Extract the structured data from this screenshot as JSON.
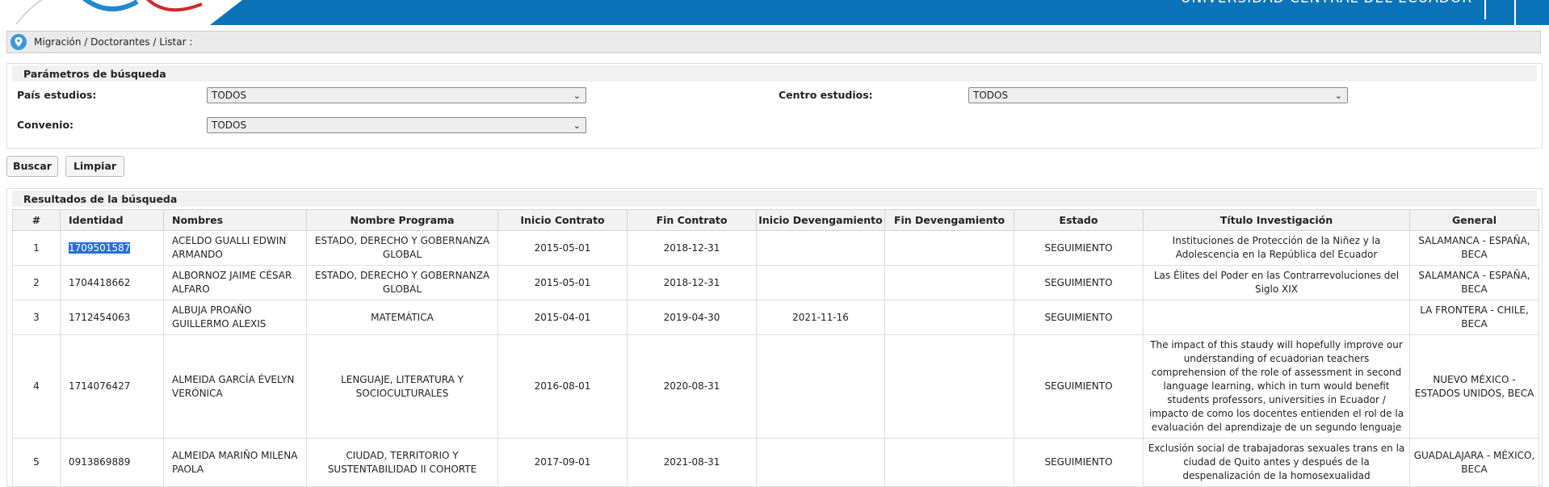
{
  "header": {
    "university": "UNIVERSIDAD CENTRAL DEL ECUADOR"
  },
  "breadcrumb": {
    "text": "Migración / Doctorantes / Listar :"
  },
  "search": {
    "title": "Parámetros de búsqueda",
    "pais_label": "País estudios:",
    "pais_value": "TODOS",
    "centro_label": "Centro estudios:",
    "centro_value": "TODOS",
    "convenio_label": "Convenio:",
    "convenio_value": "TODOS"
  },
  "buttons": {
    "buscar": "Buscar",
    "limpiar": "Limpiar"
  },
  "results": {
    "title": "Resultados de la búsqueda",
    "columns": [
      "#",
      "Identidad",
      "Nombres",
      "Nombre Programa",
      "Inicio Contrato",
      "Fin Contrato",
      "Inicio Devengamiento",
      "Fin Devengamiento",
      "Estado",
      "Título Investigación",
      "General"
    ],
    "rows": [
      {
        "num": "1",
        "identidad": "1709501587",
        "nombres": "ACELDO GUALLI EDWIN ARMANDO",
        "programa": "ESTADO, DERECHO Y GOBERNANZA GLOBAL",
        "inicio_contrato": "2015-05-01",
        "fin_contrato": "2018-12-31",
        "inicio_dev": "",
        "fin_dev": "",
        "estado": "SEGUIMIENTO",
        "titulo": "Instituciones de Protección de la Niñez y la Adolescencia en la República del Ecuador",
        "general": "SALAMANCA - ESPAÑA, BECA"
      },
      {
        "num": "2",
        "identidad": "1704418662",
        "nombres": "ALBORNOZ JAIME CÉSAR ALFARO",
        "programa": "ESTADO, DERECHO Y GOBERNANZA GLOBAL",
        "inicio_contrato": "2015-05-01",
        "fin_contrato": "2018-12-31",
        "inicio_dev": "",
        "fin_dev": "",
        "estado": "SEGUIMIENTO",
        "titulo": "Las Élites del Poder en las Contrarrevoluciones del Siglo XIX",
        "general": "SALAMANCA - ESPAÑA, BECA"
      },
      {
        "num": "3",
        "identidad": "1712454063",
        "nombres": "ALBUJA PROAÑO GUILLERMO ALEXIS",
        "programa": "MATEMÁTICA",
        "inicio_contrato": "2015-04-01",
        "fin_contrato": "2019-04-30",
        "inicio_dev": "2021-11-16",
        "fin_dev": "",
        "estado": "SEGUIMIENTO",
        "titulo": "",
        "general": "LA FRONTERA - CHILE, BECA"
      },
      {
        "num": "4",
        "identidad": "1714076427",
        "nombres": "ALMEIDA GARCÍA ÉVELYN VERÓNICA",
        "programa": "LENGUAJE, LITERATURA Y SOCIOCULTURALES",
        "inicio_contrato": "2016-08-01",
        "fin_contrato": "2020-08-31",
        "inicio_dev": "",
        "fin_dev": "",
        "estado": "SEGUIMIENTO",
        "titulo": "The impact of this staudy will hopefully improve our understanding of ecuadorian teachers comprehension of the role of assessment in second language learning, which in turn would benefit students professors, universities in Ecuador / impacto de como los docentes entienden el rol de la evaluación del aprendizaje de un segundo lenguaje",
        "general": "NUEVO MÉXICO - ESTADOS UNIDOS, BECA"
      },
      {
        "num": "5",
        "identidad": "0913869889",
        "nombres": "ALMEIDA MARIÑO MILENA PAOLA",
        "programa": "CIUDAD, TERRITORIO Y SUSTENTABILIDAD II COHORTE",
        "inicio_contrato": "2017-09-01",
        "fin_contrato": "2021-08-31",
        "inicio_dev": "",
        "fin_dev": "",
        "estado": "SEGUIMIENTO",
        "titulo": "Exclusión social de trabajadoras sexuales trans en la ciudad de Quito antes y después de la despenalización de la homosexualidad",
        "general": "GUADALAJARA - MÉXICO, BECA"
      }
    ]
  }
}
